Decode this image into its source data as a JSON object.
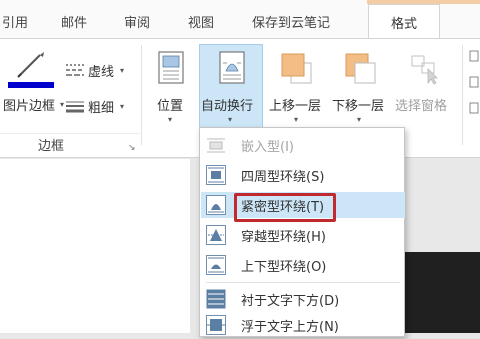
{
  "tabs": [
    {
      "label": "引用"
    },
    {
      "label": "邮件"
    },
    {
      "label": "审阅"
    },
    {
      "label": "视图"
    },
    {
      "label": "保存到云笔记"
    },
    {
      "label": "格式",
      "active": true
    }
  ],
  "ribbon": {
    "picture_border_label": "图片边框",
    "dashes_label": "虚线",
    "weight_label": "粗细",
    "border_group_label": "边框",
    "position_label": "位置",
    "wrap_text_label": "自动换行",
    "bring_forward_label": "上移一层",
    "send_backward_label": "下移一层",
    "selection_pane_label": "选择窗格",
    "border_color": "#0000cc"
  },
  "wrap_menu": {
    "items": [
      {
        "label": "嵌入型(I)",
        "icon": "inline-icon",
        "disabled": true
      },
      {
        "label": "四周型环绕(S)",
        "icon": "square-wrap-icon"
      },
      {
        "label": "紧密型环绕(T)",
        "icon": "tight-wrap-icon",
        "highlighted": true
      },
      {
        "label": "穿越型环绕(H)",
        "icon": "through-wrap-icon"
      },
      {
        "label": "上下型环绕(O)",
        "icon": "top-bottom-wrap-icon"
      },
      {
        "label": "衬于文字下方(D)",
        "icon": "behind-text-icon"
      },
      {
        "label": "浮于文字上方(N)",
        "icon": "in-front-of-text-icon"
      }
    ]
  },
  "colors": {
    "accent_orange": "#f4cda7",
    "highlight_blue": "#cde6f7",
    "red_box": "#c0292e"
  }
}
